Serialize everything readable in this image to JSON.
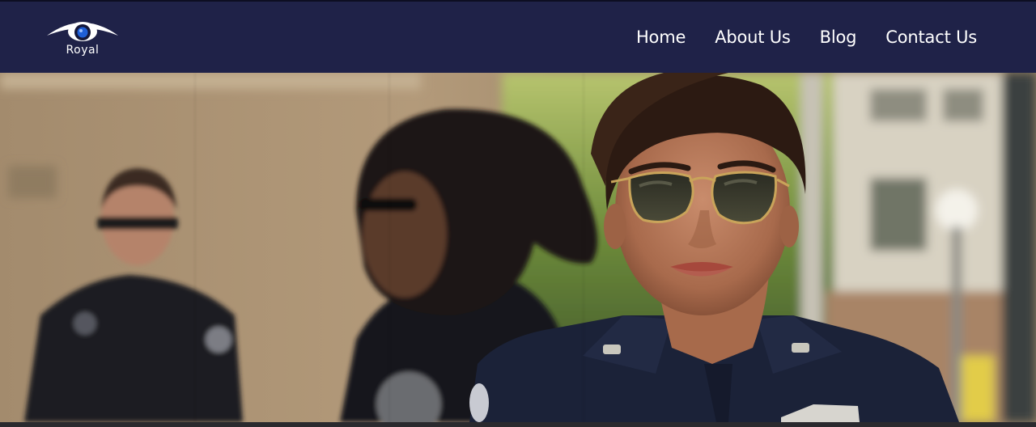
{
  "header": {
    "logo": {
      "text": "Royal",
      "icon": "eye-icon"
    },
    "nav": [
      {
        "label": "Home"
      },
      {
        "label": "About Us"
      },
      {
        "label": "Blog"
      },
      {
        "label": "Contact Us"
      }
    ]
  },
  "hero": {
    "image": "police-officers-photo"
  },
  "colors": {
    "header_bg": "#1f2248",
    "nav_text": "#ffffff",
    "logo_accent": "#1f5fd6"
  }
}
